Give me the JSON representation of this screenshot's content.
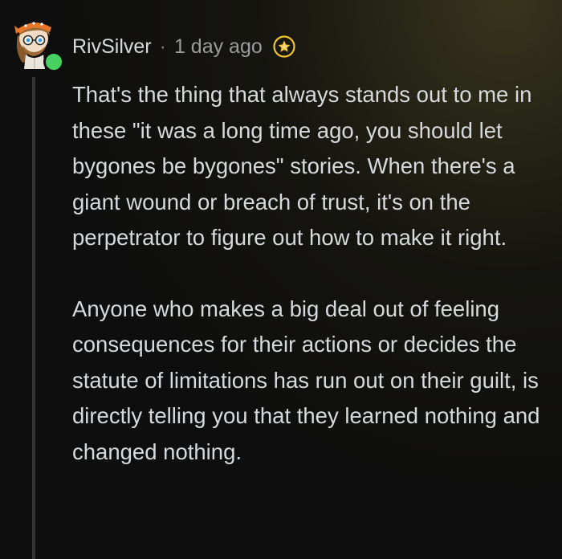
{
  "comment": {
    "username": "RivSilver",
    "separator": "·",
    "timestamp": "1 day ago",
    "avatar_icon": "snoo-avatar-icon",
    "award_icon": "award-icon",
    "online_color": "#46d160",
    "paragraphs": [
      "That's the thing that always stands out to me in these \"it was a long time ago, you should let bygones be bygones\" stories. When there's a giant wound or breach of trust, it's on the perpetrator to figure out how to make it right.",
      "Anyone who makes a big deal out of feeling consequences for their actions or decides the statute of limitations has run out on their guilt, is directly telling you that they learned nothing and changed nothing."
    ]
  }
}
